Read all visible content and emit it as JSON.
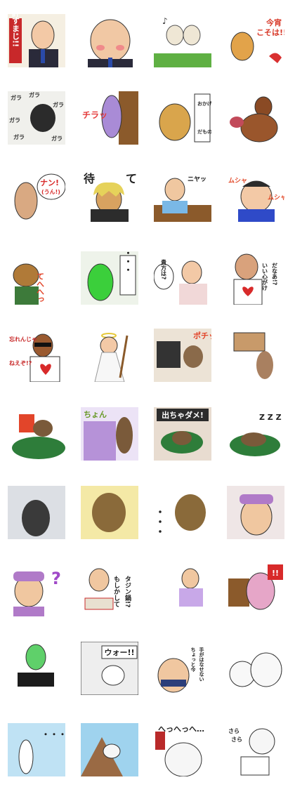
{
  "stickers": [
    {
      "name": "bald-man-forgive-sticker",
      "text_lines": [
        "許すまじ!!"
      ]
    },
    {
      "name": "bald-man-closeup-sticker",
      "text_lines": []
    },
    {
      "name": "dancing-bulbs-sticker",
      "text_lines": [
        "♪"
      ]
    },
    {
      "name": "reindeer-sticker",
      "text_lines": [
        "今宵",
        "こそは!!"
      ]
    },
    {
      "name": "gorilla-rattle-sticker",
      "text_lines": [
        "ガラ",
        "ガラ",
        "ガラ",
        "ガラ",
        "ガラ",
        "ガラ"
      ]
    },
    {
      "name": "peeking-purple-sticker",
      "text_lines": [
        "チラッ"
      ]
    },
    {
      "name": "potato-sticker",
      "text_lines": [
        "おかげさまで",
        "だもの"
      ]
    },
    {
      "name": "muscle-man-sticker",
      "text_lines": []
    },
    {
      "name": "bread-creature-sticker",
      "text_lines": [
        "ナン!",
        "(うん!)"
      ]
    },
    {
      "name": "wrestler-wait-sticker",
      "text_lines": [
        "待",
        "て"
      ]
    },
    {
      "name": "grinning-man-sticker",
      "text_lines": [
        "ニヤッ"
      ]
    },
    {
      "name": "angry-kid-sticker",
      "text_lines": [
        "ムシャ",
        "ムシャ"
      ]
    },
    {
      "name": "raccoon-sticker",
      "text_lines": [
        "てへへっ"
      ]
    },
    {
      "name": "green-blob-sticker",
      "text_lines": [
        "・・・"
      ]
    },
    {
      "name": "braided-lady-sticker",
      "text_lines": [
        "貴方は?"
      ]
    },
    {
      "name": "heart-man-sticker",
      "text_lines": [
        "いい心がけ",
        "だなあ!?"
      ]
    },
    {
      "name": "sunglasses-man-sticker",
      "text_lines": [
        "忘れんじゃ",
        "ねえぞ!?"
      ]
    },
    {
      "name": "wizard-sticker",
      "text_lines": []
    },
    {
      "name": "dog-laptop-sticker",
      "text_lines": [
        "ポチッ"
      ]
    },
    {
      "name": "dog-box-sticker",
      "text_lines": []
    },
    {
      "name": "dog-book-sticker",
      "text_lines": []
    },
    {
      "name": "dog-peek-sticker",
      "text_lines": [
        "ちょん"
      ]
    },
    {
      "name": "dog-cushion-no-sticker",
      "text_lines": [
        "出ちゃダメ!"
      ]
    },
    {
      "name": "dog-sleep-sticker",
      "text_lines": [
        "Z Z Z"
      ]
    },
    {
      "name": "dog-back-sticker",
      "text_lines": []
    },
    {
      "name": "dog-face-burst-sticker",
      "text_lines": []
    },
    {
      "name": "dog-dots-sticker",
      "text_lines": [
        "・・・"
      ]
    },
    {
      "name": "curler-lady-glare-sticker",
      "text_lines": []
    },
    {
      "name": "curler-lady-question-sticker",
      "text_lines": [
        "?"
      ]
    },
    {
      "name": "lady-gift-sticker",
      "text_lines": [
        "もしかして",
        "タジン鍋!?"
      ]
    },
    {
      "name": "lady-walking-sticker",
      "text_lines": []
    },
    {
      "name": "pink-creature-sticker",
      "text_lines": [
        "!!"
      ]
    },
    {
      "name": "green-face-phone-sticker",
      "text_lines": []
    },
    {
      "name": "comic-wow-sticker",
      "text_lines": [
        "ウォー!!"
      ]
    },
    {
      "name": "sumo-sticker",
      "text_lines": [
        "ちょっと今",
        "手がはなせない"
      ]
    },
    {
      "name": "white-cats-sticker",
      "text_lines": []
    },
    {
      "name": "bowling-pin-sticker",
      "text_lines": [
        "・・・"
      ]
    },
    {
      "name": "cliff-creature-sticker",
      "text_lines": []
    },
    {
      "name": "laughing-face-sticker",
      "text_lines": [
        "へっへっへ…"
      ]
    },
    {
      "name": "cat-painting-sticker",
      "text_lines": [
        "さら",
        "さら"
      ]
    }
  ]
}
